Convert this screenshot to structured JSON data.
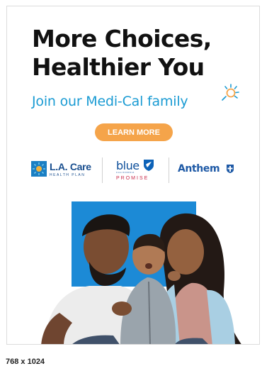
{
  "ad": {
    "headline": [
      "More Choices,",
      "Healthier You"
    ],
    "subheadline": "Join our Medi-Cal family",
    "cta_label": "LEARN MORE",
    "logos": {
      "lacare": {
        "name": "L.A. Care",
        "tagline": "HEALTH PLAN"
      },
      "blue": {
        "word": "blue",
        "state": "CALIFORNIA",
        "promise": "PROMISE"
      },
      "anthem": {
        "word": "Anthem"
      }
    }
  },
  "footer": {
    "size_label": "768 x 1024"
  },
  "colors": {
    "headline": "#111111",
    "accent": "#1a9bd3",
    "cta": "#f5a44a",
    "photo_block": "#1c8ad6"
  },
  "icons": [
    "sun-icon",
    "lacare-logo-icon",
    "blue-shield-icon",
    "anthem-cross-icon"
  ]
}
